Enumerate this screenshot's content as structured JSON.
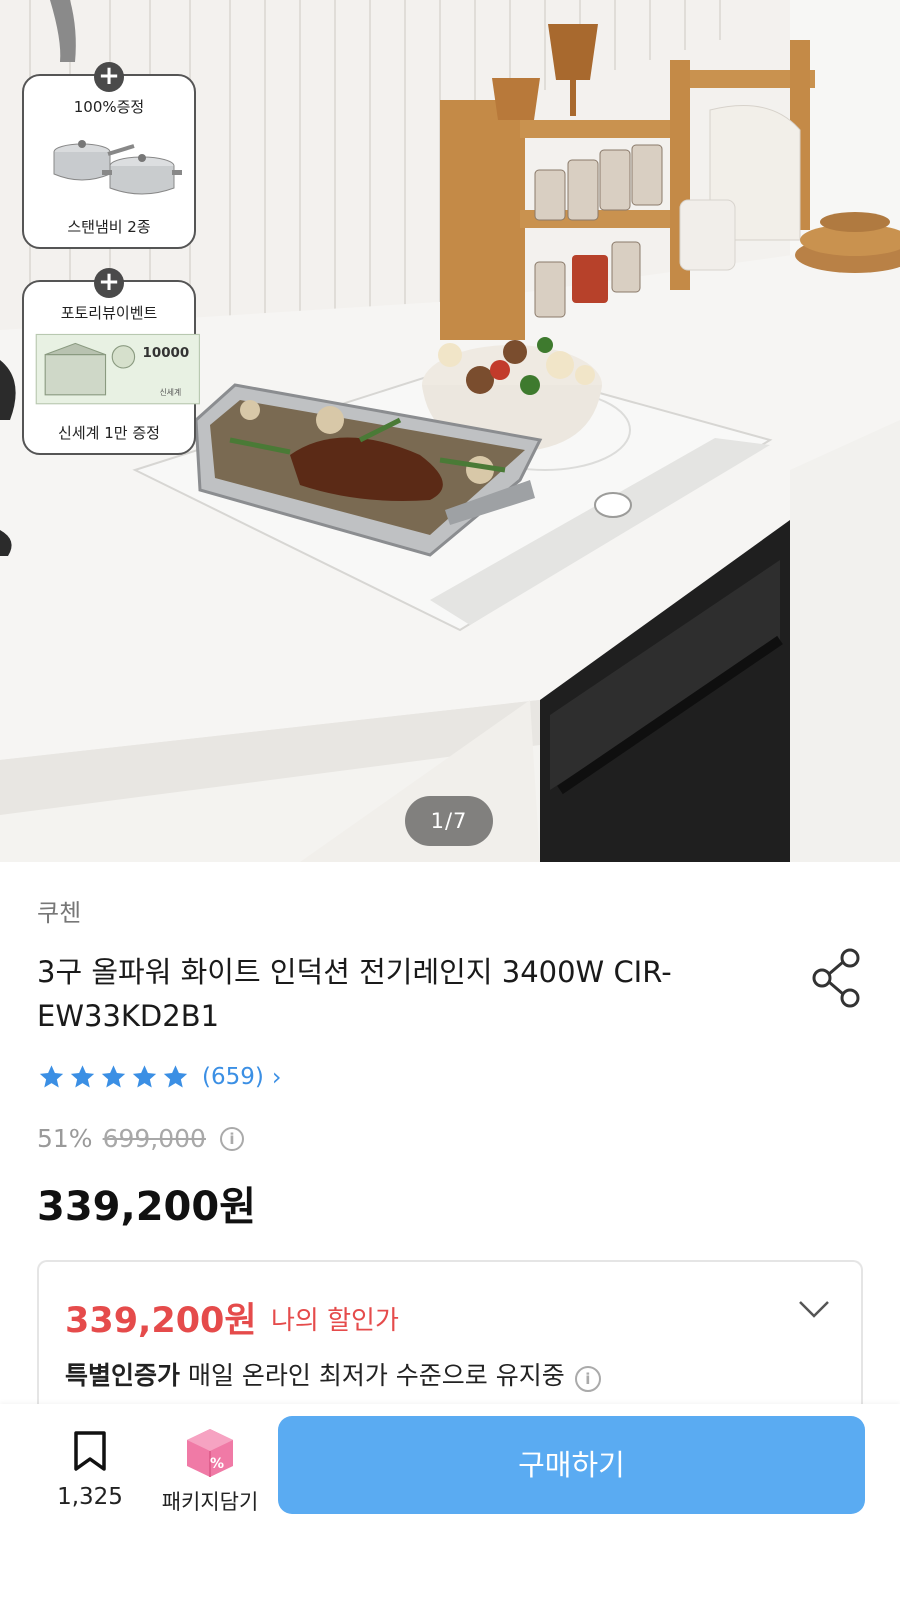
{
  "hero": {
    "gift1": {
      "title": "100%증정",
      "caption": "스탠냄비 2종"
    },
    "gift2": {
      "title": "포토리뷰이벤트",
      "caption": "신세계 1만 증정",
      "voucher_value": "10000",
      "voucher_brand": "신세계"
    },
    "counter": "1/7"
  },
  "product": {
    "brand": "쿠첸",
    "title": "3구 올파워 화이트 인덕션 전기레인지 3400W CIR-EW33KD2B1",
    "rating_stars": 5,
    "review_count": "(659)",
    "discount": "51%",
    "original_price": "699,000",
    "price": "339,200원"
  },
  "promo": {
    "price": "339,200원",
    "label": "나의 할인가",
    "note_bold": "특별인증가",
    "note_text": " 매일 온라인 최저가 수준으로 유지중"
  },
  "bottom": {
    "bookmark_count": "1,325",
    "package_label": "패키지담기",
    "buy_label": "구매하기"
  },
  "colors": {
    "accent_blue": "#5aabf2",
    "star_blue": "#3b8fe4",
    "promo_red": "#e54b4b",
    "package_pink": "#f07aa6"
  },
  "icons": {
    "share": "share-icon",
    "star": "star-icon",
    "chevron_right": "chevron-right-icon",
    "chevron_down": "chevron-down-icon",
    "info": "info-icon",
    "bookmark": "bookmark-icon",
    "package": "package-box-icon",
    "plus": "plus-icon"
  }
}
